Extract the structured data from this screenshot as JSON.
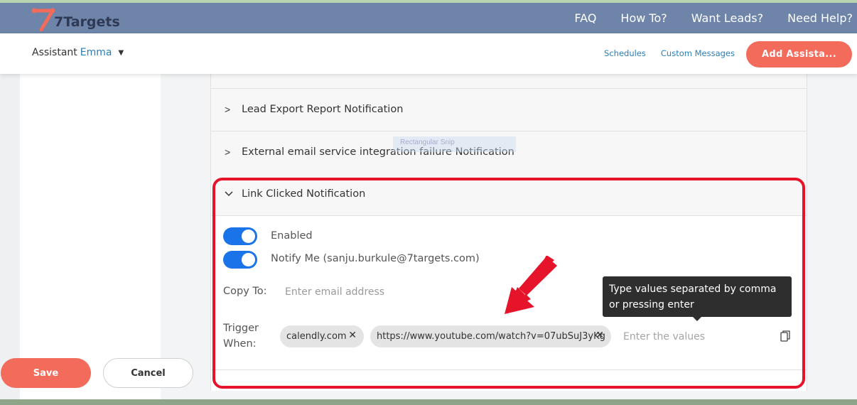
{
  "brand": {
    "name": "7Targets",
    "colors": {
      "primary": "#f26b5b",
      "nav": "#6e84a8",
      "toggle": "#1a73e8",
      "highlight": "#e5142b"
    }
  },
  "top_nav": [
    "FAQ",
    "How To?",
    "Want Leads?",
    "Need Help?"
  ],
  "subheader": {
    "assistant_prefix": "Assistant",
    "assistant_name": "Emma",
    "links": [
      "Schedules",
      "Custom Messages"
    ],
    "add_button": "Add Assista..."
  },
  "notifications": [
    {
      "title": "Lead Export Report Notification",
      "expanded": false
    },
    {
      "title": "External email service integration failure Notification",
      "expanded": false
    },
    {
      "title": "Link Clicked Notification",
      "expanded": true
    }
  ],
  "link_clicked": {
    "enabled_label": "Enabled",
    "enabled": true,
    "notify_label": "Notify Me (sanju.burkule@7targets.com)",
    "notify": true,
    "copy_to_label": "Copy To:",
    "copy_to_placeholder": "Enter email address",
    "trigger_label_line1": "Trigger",
    "trigger_label_line2": "When:",
    "trigger_values": [
      "calendly.com",
      "https://www.youtube.com/watch?v=07ubSuJ3yKg"
    ],
    "trigger_placeholder": "Enter the values",
    "tooltip": "Type values separated by comma or pressing enter"
  },
  "ghost_text": "Rectangular Snip",
  "actions": {
    "save": "Save",
    "cancel": "Cancel"
  },
  "icons": [
    "chevron-right-icon",
    "chevron-down-icon",
    "caret-down-icon",
    "close-icon",
    "copy-icon",
    "red-arrow-annotation"
  ]
}
